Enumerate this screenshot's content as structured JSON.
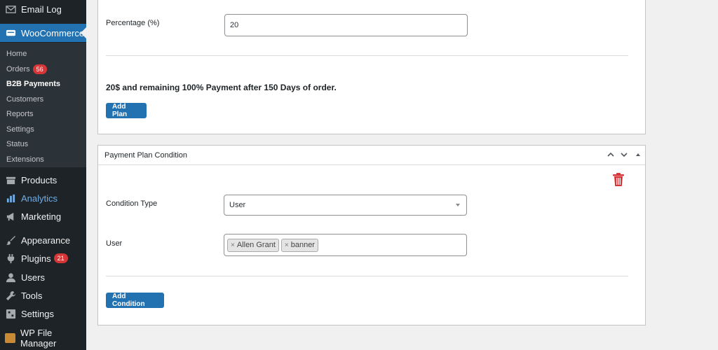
{
  "sidebar": {
    "email_log": "Email Log",
    "woocommerce": "WooCommerce",
    "submenu": {
      "home": "Home",
      "orders": "Orders",
      "orders_badge": "56",
      "b2b_payments": "B2B Payments",
      "customers": "Customers",
      "reports": "Reports",
      "settings": "Settings",
      "status": "Status",
      "extensions": "Extensions"
    },
    "products": "Products",
    "analytics": "Analytics",
    "marketing": "Marketing",
    "appearance": "Appearance",
    "plugins": "Plugins",
    "plugins_badge": "21",
    "users": "Users",
    "tools": "Tools",
    "settings": "Settings",
    "wp_file_manager": "WP File Manager"
  },
  "plan": {
    "percentage_label": "Percentage (%)",
    "percentage_value": "20",
    "summary": "20$ and remaining 100% Payment after 150 Days of order.",
    "add_plan_label": "Add Plan"
  },
  "condition": {
    "title": "Payment Plan Condition",
    "condition_type_label": "Condition Type",
    "condition_type_value": "User",
    "user_label": "User",
    "selected_users": [
      "Allen Grant",
      "banner"
    ],
    "add_condition_label": "Add Condition"
  },
  "colors": {
    "sidebar_bg": "#1d2327",
    "accent": "#2271b1",
    "badge": "#d63638",
    "trash": "#d63638"
  }
}
